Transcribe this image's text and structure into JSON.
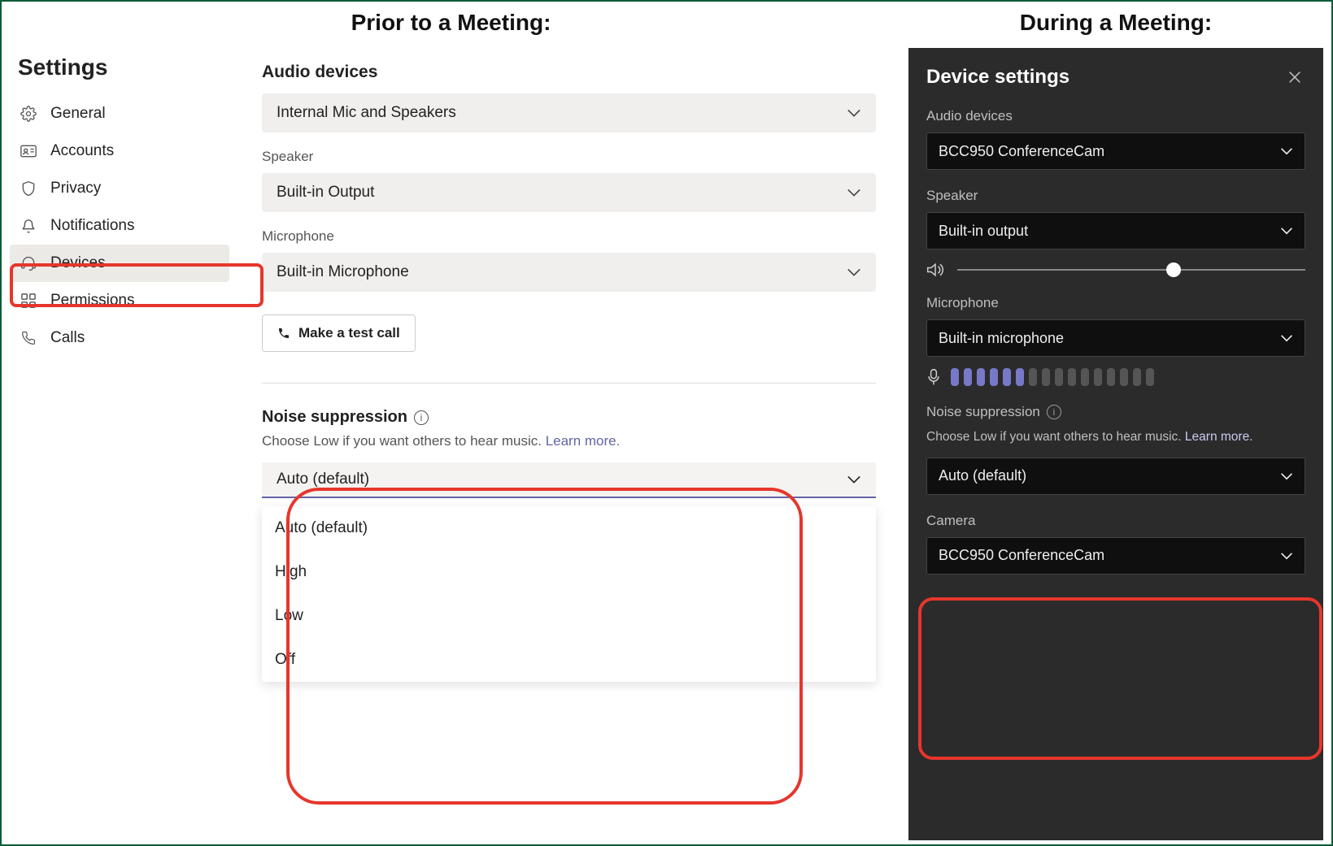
{
  "headings": {
    "prior": "Prior to a Meeting:",
    "during": "During a Meeting:"
  },
  "light": {
    "title": "Settings",
    "nav": {
      "general": "General",
      "accounts": "Accounts",
      "privacy": "Privacy",
      "notifications": "Notifications",
      "devices": "Devices",
      "permissions": "Permissions",
      "calls": "Calls"
    },
    "audio_devices_title": "Audio devices",
    "audio_device_select": "Internal Mic and Speakers",
    "speaker_label": "Speaker",
    "speaker_select": "Built-in Output",
    "microphone_label": "Microphone",
    "microphone_select": "Built-in Microphone",
    "test_call": "Make a test call",
    "ns_title": "Noise suppression",
    "ns_desc": "Choose Low if you want others to hear music. ",
    "learn_more": "Learn more.",
    "ns_selected": "Auto (default)",
    "ns_options": [
      "Auto (default)",
      "High",
      "Low",
      "Off"
    ]
  },
  "dark": {
    "title": "Device settings",
    "audio_devices_label": "Audio devices",
    "audio_device_select": "BCC950 ConferenceCam",
    "speaker_label": "Speaker",
    "speaker_select": "Built-in output",
    "microphone_label": "Microphone",
    "microphone_select": "Built-in microphone",
    "ns_title": "Noise suppression",
    "ns_desc": "Choose Low if you want others to hear music. ",
    "learn_more": "Learn more.",
    "ns_selected": "Auto (default)",
    "camera_label": "Camera",
    "camera_select": "BCC950 ConferenceCam"
  }
}
